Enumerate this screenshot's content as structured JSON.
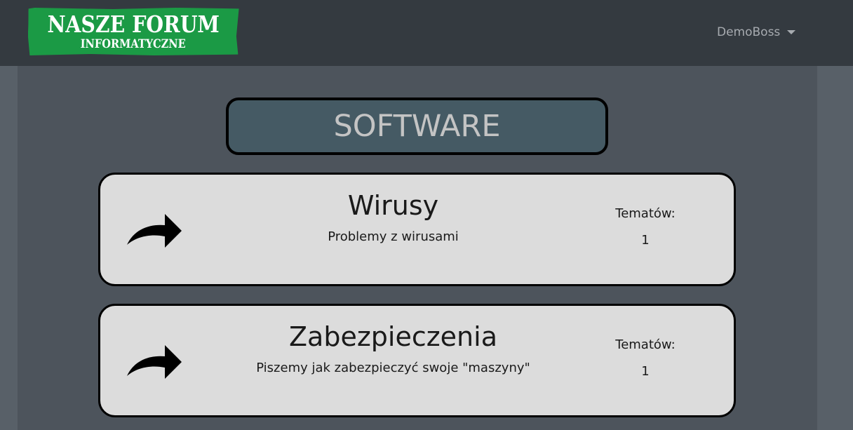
{
  "header": {
    "logo_main": "NASZE FORUM",
    "logo_sub": "INFORMATYCZNE",
    "user_name": "DemoBoss",
    "logo_color": "#1b9a45"
  },
  "section": {
    "title": "SOFTWARE"
  },
  "forums": [
    {
      "title": "Wirusy",
      "description": "Problemy z wirusami",
      "topics_label": "Tematów:",
      "topics_count": "1",
      "icon": "share-arrow-icon"
    },
    {
      "title": "Zabezpieczenia",
      "description": "Piszemy jak zabezpieczyć swoje \"maszyny\"",
      "topics_label": "Tematów:",
      "topics_count": "1",
      "icon": "share-arrow-icon"
    }
  ]
}
